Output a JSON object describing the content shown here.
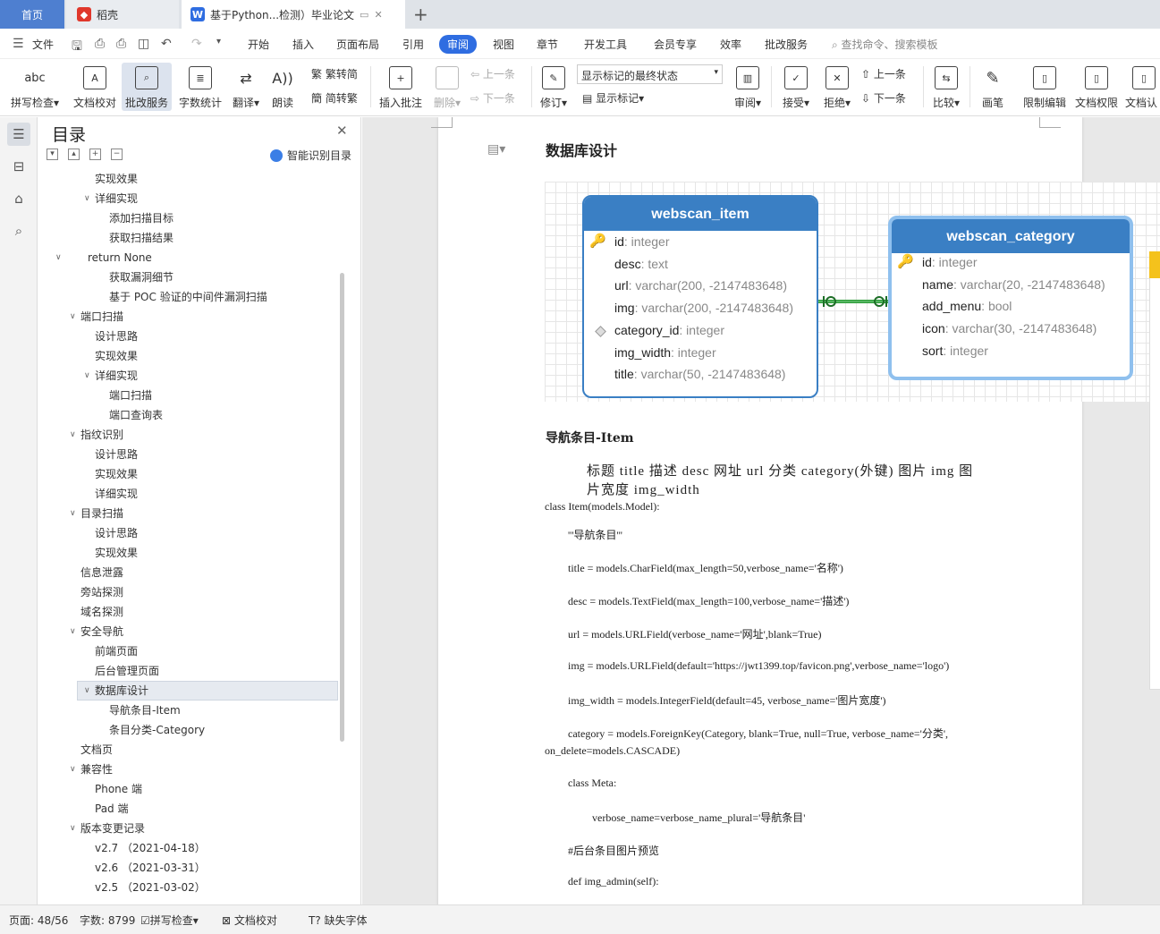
{
  "tabs": {
    "home": "首页",
    "daoke": "稻壳",
    "doc": "基于Python...检测）毕业论文"
  },
  "menu": {
    "file": "文件",
    "items": [
      "开始",
      "插入",
      "页面布局",
      "引用",
      "审阅",
      "视图",
      "章节",
      "开发工具",
      "会员专享",
      "效率",
      "批改服务"
    ],
    "search": "查找命令、搜索模板"
  },
  "ribbon": {
    "spellcheck": "拼写检查",
    "doc_check": "文档校对",
    "correct_service": "批改服务",
    "word_count": "字数统计",
    "translate": "翻译",
    "read_aloud": "朗读",
    "simp_to_trad": "繁转简",
    "trad_to_simp": "简转繁",
    "insert_comment": "插入批注",
    "delete": "删除",
    "prev": "上一条",
    "next": "下一条",
    "revise": "修订",
    "markup_select": "显示标记的最终状态",
    "show_markup": "显示标记",
    "review": "审阅",
    "accept": "接受",
    "reject": "拒绝",
    "prev2": "上一条",
    "next2": "下一条",
    "compare": "比较",
    "pen": "画笔",
    "restrict_edit": "限制编辑",
    "doc_permission": "文档权限",
    "doc_cert": "文档认"
  },
  "toc": {
    "title": "目录",
    "smart": "智能识别目录",
    "items": [
      {
        "label": "实现效果",
        "level": 3
      },
      {
        "label": "详细实现",
        "level": 3,
        "chev": true
      },
      {
        "label": "添加扫描目标",
        "level": 4
      },
      {
        "label": "获取扫描结果",
        "level": 4
      },
      {
        "label": "return None",
        "level": 1,
        "chev": true
      },
      {
        "label": "获取漏洞细节",
        "level": 4
      },
      {
        "label": "基于 POC 验证的中间件漏洞扫描",
        "level": 4
      },
      {
        "label": "端口扫描",
        "level": 2,
        "chev": true
      },
      {
        "label": "设计思路",
        "level": 3
      },
      {
        "label": "实现效果",
        "level": 3
      },
      {
        "label": "详细实现",
        "level": 3,
        "chev": true
      },
      {
        "label": "端口扫描",
        "level": 4
      },
      {
        "label": "端口查询表",
        "level": 4
      },
      {
        "label": "指纹识别",
        "level": 2,
        "chev": true
      },
      {
        "label": "设计思路",
        "level": 3
      },
      {
        "label": "实现效果",
        "level": 3
      },
      {
        "label": "详细实现",
        "level": 3
      },
      {
        "label": "目录扫描",
        "level": 2,
        "chev": true
      },
      {
        "label": "设计思路",
        "level": 3
      },
      {
        "label": "实现效果",
        "level": 3
      },
      {
        "label": "信息泄露",
        "level": 2
      },
      {
        "label": "旁站探测",
        "level": 2
      },
      {
        "label": "域名探测",
        "level": 2
      },
      {
        "label": "安全导航",
        "level": 2,
        "chev": true
      },
      {
        "label": "前端页面",
        "level": 3
      },
      {
        "label": "后台管理页面",
        "level": 3
      },
      {
        "label": "数据库设计",
        "level": 3,
        "chev": true,
        "selected": true
      },
      {
        "label": "导航条目-Item",
        "level": 4
      },
      {
        "label": "条目分类-Category",
        "level": 4
      },
      {
        "label": "文档页",
        "level": 2
      },
      {
        "label": "兼容性",
        "level": 2,
        "chev": true
      },
      {
        "label": "Phone 端",
        "level": 3
      },
      {
        "label": "Pad 端",
        "level": 3
      },
      {
        "label": "版本变更记录",
        "level": 2,
        "chev": true
      },
      {
        "label": "v2.7 （2021-04-18）",
        "level": 3
      },
      {
        "label": "v2.6 （2021-03-31）",
        "level": 3
      },
      {
        "label": "v2.5 （2021-03-02）",
        "level": 3
      }
    ]
  },
  "doc": {
    "heading_db": "数据库设计",
    "er": {
      "item_table": "webscan_item",
      "item_fields": [
        {
          "name": "id",
          "type": ": integer",
          "pk": true
        },
        {
          "name": "desc",
          "type": ": text"
        },
        {
          "name": "url",
          "type": ": varchar(200, -2147483648)"
        },
        {
          "name": "img",
          "type": ": varchar(200, -2147483648)"
        },
        {
          "name": "category_id",
          "type": ": integer",
          "fk": true
        },
        {
          "name": "img_width",
          "type": ": integer"
        },
        {
          "name": "title",
          "type": ": varchar(50, -2147483648)"
        }
      ],
      "category_table": "webscan_category",
      "category_fields": [
        {
          "name": "id",
          "type": ": integer",
          "pk": true
        },
        {
          "name": "name",
          "type": ": varchar(20, -2147483648)"
        },
        {
          "name": "add_menu",
          "type": ": bool"
        },
        {
          "name": "icon",
          "type": ": varchar(30, -2147483648)"
        },
        {
          "name": "sort",
          "type": ": integer"
        }
      ]
    },
    "heading_item": "导航条目-Item",
    "para1": "标题 title 描述 desc 网址 url 分类 category(外键) 图片 img 图",
    "para2": "片宽度 img_width",
    "code": [
      "class Item(models.Model):",
      "'''导航条目'''",
      "title = models.CharField(max_length=50,verbose_name='名称')",
      "desc = models.TextField(max_length=100,verbose_name='描述')",
      "url = models.URLField(verbose_name='网址',blank=True)",
      "img = models.URLField(default='https://jwt1399.top/favicon.png',verbose_name='logo')",
      "img_width = models.IntegerField(default=45, verbose_name='图片宽度')",
      "category = models.ForeignKey(Category, blank=True, null=True, verbose_name='分类',",
      "on_delete=models.CASCADE)",
      "class Meta:",
      "verbose_name=verbose_name_plural='导航条目'",
      "#后台条目图片预览",
      "def img_admin(self):"
    ]
  },
  "status": {
    "page": "页面: 48/56",
    "words": "字数: 8799",
    "spell": "拼写检查",
    "proof": "文档校对",
    "missing_font": "缺失字体"
  },
  "colors": {
    "accent": "#2f6de1",
    "home_tab": "#4e7fd0",
    "er_header": "#3a7fc4",
    "relation_line": "#2e9c3a"
  }
}
